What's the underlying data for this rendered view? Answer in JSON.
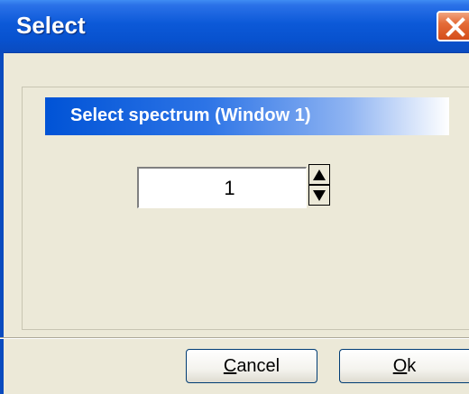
{
  "window": {
    "title": "Select",
    "close_icon": "close-x-icon"
  },
  "banner": {
    "text": "Select spectrum (Window 1)"
  },
  "spinner": {
    "value": "1",
    "up_icon": "arrow-up-icon",
    "down_icon": "arrow-down-icon"
  },
  "buttons": {
    "cancel_accel": "C",
    "cancel_rest": "ancel",
    "ok_accel": "O",
    "ok_rest": "k"
  },
  "colors": {
    "titlebar": "#0c59d8",
    "dialog_bg": "#ece9d8",
    "close_button": "#e46c38",
    "banner_start": "#0053d6"
  }
}
